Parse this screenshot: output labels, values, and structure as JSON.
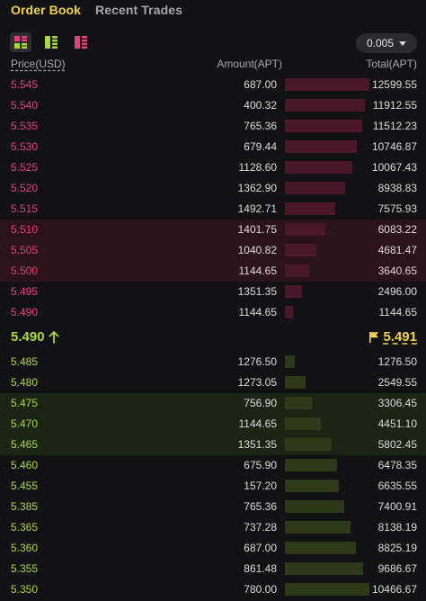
{
  "tabs": [
    {
      "label": "Order Book",
      "active": true
    },
    {
      "label": "Recent Trades",
      "active": false
    }
  ],
  "toolbar": {
    "views": [
      "both-sides-view-icon",
      "bids-only-view-icon",
      "asks-only-view-icon"
    ],
    "selected_view": 0,
    "tick_size": "0.005"
  },
  "columns": {
    "price": "Price(USD)",
    "amount": "Amount(APT)",
    "total": "Total(APT)"
  },
  "colors": {
    "ask": "#e3407a",
    "bid": "#a8d93c",
    "accent": "#f1d24a",
    "ask_highlight": "#2b121b",
    "bid_highlight": "#1a2514"
  },
  "asks": [
    {
      "price": "5.545",
      "amount": "687.00",
      "total": "12599.55",
      "depth": 1.0,
      "highlight": false
    },
    {
      "price": "5.540",
      "amount": "400.32",
      "total": "11912.55",
      "depth": 0.945,
      "highlight": false
    },
    {
      "price": "5.535",
      "amount": "765.36",
      "total": "11512.23",
      "depth": 0.914,
      "highlight": false
    },
    {
      "price": "5.530",
      "amount": "679.44",
      "total": "10746.87",
      "depth": 0.853,
      "highlight": false
    },
    {
      "price": "5.525",
      "amount": "1128.60",
      "total": "10067.43",
      "depth": 0.799,
      "highlight": false
    },
    {
      "price": "5.520",
      "amount": "1362.90",
      "total": "8938.83",
      "depth": 0.709,
      "highlight": false
    },
    {
      "price": "5.515",
      "amount": "1492.71",
      "total": "7575.93",
      "depth": 0.601,
      "highlight": false
    },
    {
      "price": "5.510",
      "amount": "1401.75",
      "total": "6083.22",
      "depth": 0.483,
      "highlight": true
    },
    {
      "price": "5.505",
      "amount": "1040.82",
      "total": "4681.47",
      "depth": 0.372,
      "highlight": true
    },
    {
      "price": "5.500",
      "amount": "1144.65",
      "total": "3640.65",
      "depth": 0.289,
      "highlight": true
    },
    {
      "price": "5.495",
      "amount": "1351.35",
      "total": "2496.00",
      "depth": 0.198,
      "highlight": false
    },
    {
      "price": "5.490",
      "amount": "1144.65",
      "total": "1144.65",
      "depth": 0.091,
      "highlight": false
    }
  ],
  "mid": {
    "last_price": "5.490",
    "direction_icon": "arrow-up-icon",
    "mark_icon": "flag-icon",
    "mark_price": "5.491"
  },
  "bids": [
    {
      "price": "5.485",
      "amount": "1276.50",
      "total": "1276.50",
      "depth": 0.122,
      "highlight": false
    },
    {
      "price": "5.480",
      "amount": "1273.05",
      "total": "2549.55",
      "depth": 0.244,
      "highlight": false
    },
    {
      "price": "5.475",
      "amount": "756.90",
      "total": "3306.45",
      "depth": 0.316,
      "highlight": true
    },
    {
      "price": "5.470",
      "amount": "1144.65",
      "total": "4451.10",
      "depth": 0.425,
      "highlight": true
    },
    {
      "price": "5.465",
      "amount": "1351.35",
      "total": "5802.45",
      "depth": 0.554,
      "highlight": true
    },
    {
      "price": "5.460",
      "amount": "675.90",
      "total": "6478.35",
      "depth": 0.619,
      "highlight": false
    },
    {
      "price": "5.455",
      "amount": "157.20",
      "total": "6635.55",
      "depth": 0.634,
      "highlight": false
    },
    {
      "price": "5.385",
      "amount": "765.36",
      "total": "7400.91",
      "depth": 0.707,
      "highlight": false
    },
    {
      "price": "5.365",
      "amount": "737.28",
      "total": "8138.19",
      "depth": 0.777,
      "highlight": false
    },
    {
      "price": "5.360",
      "amount": "687.00",
      "total": "8825.19",
      "depth": 0.843,
      "highlight": false
    },
    {
      "price": "5.355",
      "amount": "861.48",
      "total": "9686.67",
      "depth": 0.925,
      "highlight": false
    },
    {
      "price": "5.350",
      "amount": "780.00",
      "total": "10466.67",
      "depth": 1.0,
      "highlight": false
    }
  ]
}
